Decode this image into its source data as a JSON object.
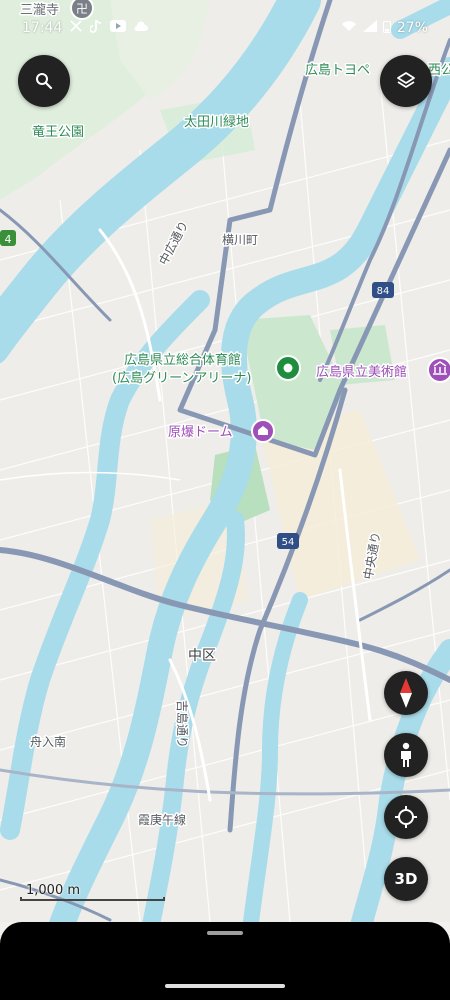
{
  "status_bar": {
    "time": "17:44",
    "battery": "27%",
    "notification_icons": [
      "x-icon",
      "tiktok-icon",
      "youtube-icon",
      "cloud-icon"
    ]
  },
  "map": {
    "labels": {
      "sanrou": "三瀧寺",
      "toyopet": "広島トヨペ",
      "toyopet_tail": "西公",
      "ryuo_park": "竜王公園",
      "otagawa_green": "太田川緑地",
      "yokogawa": "横川町",
      "nakahiro": "中広通り",
      "arena_1": "広島県立総合体育館",
      "arena_2": "(広島グリーンアリーナ)",
      "museum": "広島県立美術館",
      "dome": "原爆ドーム",
      "chuo_dori": "中央通り",
      "naka_ku": "中区",
      "yoshijima": "吉島通り",
      "funairi": "舟入南",
      "kasumi": "霞庚午線"
    },
    "route_shields": [
      "4",
      "84",
      "54"
    ],
    "scale_label": "1,000 m",
    "colors": {
      "water": "#a9dcea",
      "road_major": "#8898b4",
      "park": "#cbe8cf",
      "poi_purple": "#9e4fb8",
      "poi_green": "#1e8e3e",
      "label_blue": "#2b6cb0",
      "label_green": "#2e8b57"
    }
  },
  "controls": {
    "search_icon": "search-icon",
    "layers_icon": "layers-icon",
    "compass_icon": "compass-icon",
    "streetview_icon": "pegman-icon",
    "locate_icon": "my-location-icon",
    "three_d_label": "3D"
  }
}
